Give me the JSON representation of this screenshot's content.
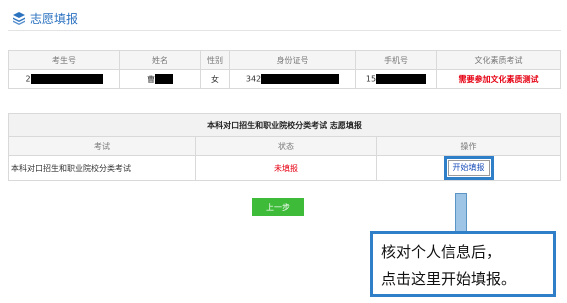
{
  "header": {
    "title": "志愿填报",
    "icon": "layers-icon"
  },
  "student_table": {
    "headers": [
      "考生号",
      "姓名",
      "性别",
      "身份证号",
      "手机号",
      "文化素质考试"
    ],
    "row": {
      "exam_no": "2",
      "name": "曹",
      "gender": "女",
      "id_no": "342",
      "phone": "15",
      "culture_exam": "需要参加文化素质测试"
    }
  },
  "apply_table": {
    "caption": "本科对口招生和职业院校分类考试 志愿填报",
    "headers": [
      "考试",
      "状态",
      "操作"
    ],
    "row": {
      "exam": "本科对口招生和职业院校分类考试",
      "status": "未填报",
      "action": "开始填报"
    }
  },
  "prev_button": "上一步",
  "callout": {
    "line1": "核对个人信息后，",
    "line2": "点击这里开始填报。"
  },
  "colors": {
    "accent": "#2b72c0",
    "warn": "#e60012",
    "green": "#3fbb3a",
    "highlight": "#2e7fc8"
  }
}
